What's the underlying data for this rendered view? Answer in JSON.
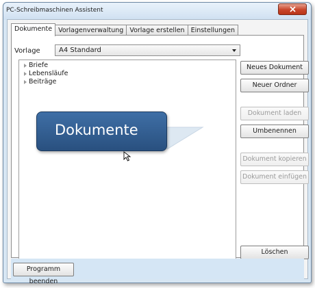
{
  "window": {
    "title": "PC-Schreibmaschinen Assistent"
  },
  "tabs": [
    "Dokumente",
    "Vorlagenverwaltung",
    "Vorlage erstellen",
    "Einstellungen"
  ],
  "vorlage": {
    "label": "Vorlage",
    "selected": "A4 Standard"
  },
  "tree": {
    "items": [
      "Briefe",
      "Lebensläufe",
      "Beiträge"
    ]
  },
  "buttons": {
    "neues_dokument": "Neues Dokument",
    "neuer_ordner": "Neuer Ordner",
    "dokument_laden": "Dokument laden",
    "umbenennen": "Umbenennen",
    "dokument_kopieren": "Dokument kopieren",
    "dokument_einfuegen": "Dokument einfügen",
    "loeschen": "Löschen",
    "programm_beenden": "Programm beenden"
  },
  "callout": {
    "text": "Dokumente"
  },
  "icons": {
    "close": "close-icon",
    "expander": "triangle-right-icon",
    "dropdown": "chevron-down-icon",
    "cursor": "mouse-pointer-icon"
  },
  "colors": {
    "accent": "#2e5a8c",
    "close": "#c9462b",
    "bottom_bar": "#d5e6f5"
  }
}
